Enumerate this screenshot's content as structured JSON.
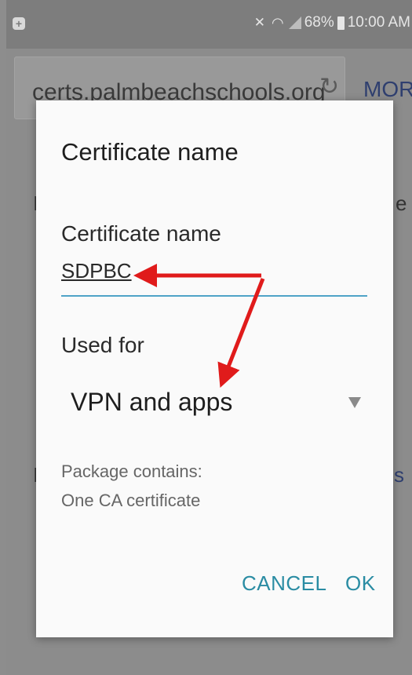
{
  "status_bar": {
    "battery": "68%",
    "time": "10:00 AM"
  },
  "browser": {
    "url": "certs.palmbeachschools.org",
    "more_label": "MORE",
    "bg_left_char": "I",
    "bg_right_char": "e",
    "bg_left_char_2": "I",
    "bg_right_char_2": "s"
  },
  "dialog": {
    "title": "Certificate name",
    "cert_name_label": "Certificate name",
    "cert_name_value": "SDPBC",
    "used_for_label": "Used for",
    "used_for_value": "VPN and apps",
    "package_label": "Package contains:",
    "package_value": "One CA certificate",
    "cancel_label": "CANCEL",
    "ok_label": "OK"
  },
  "colors": {
    "accent": "#2a8ca3",
    "underline": "#4fa3c7",
    "arrow": "#e01b1b"
  }
}
